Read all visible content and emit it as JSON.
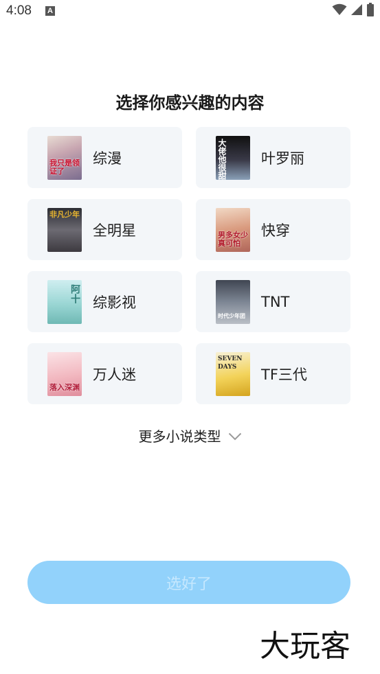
{
  "status_bar": {
    "time": "4:08",
    "notification_icon": "A",
    "icons": [
      "wifi-icon",
      "signal-icon",
      "battery-icon"
    ]
  },
  "title": "选择你感兴趣的内容",
  "categories": [
    {
      "label": "综漫",
      "cover_text": "我只是领证了"
    },
    {
      "label": "叶罗丽",
      "cover_text": "大佬他很甜"
    },
    {
      "label": "全明星",
      "cover_text": "非凡少年"
    },
    {
      "label": "快穿",
      "cover_text": "男多女少真可怕"
    },
    {
      "label": "综影视",
      "cover_text": "阿十"
    },
    {
      "label": "TNT",
      "cover_text": "时代少年团"
    },
    {
      "label": "万人迷",
      "cover_text": "落入深渊"
    },
    {
      "label": "TF三代",
      "cover_text": "SEVEN DAYS"
    }
  ],
  "more_types": {
    "label": "更多小说类型",
    "icon": "chevron-down-icon"
  },
  "confirm_button": {
    "label": "选好了",
    "state": "disabled"
  },
  "watermark": "大玩客",
  "colors": {
    "card_bg": "#f3f6f9",
    "button_bg": "#92d2fb",
    "button_text": "#c6e8fe",
    "title": "#1a1a1a"
  }
}
